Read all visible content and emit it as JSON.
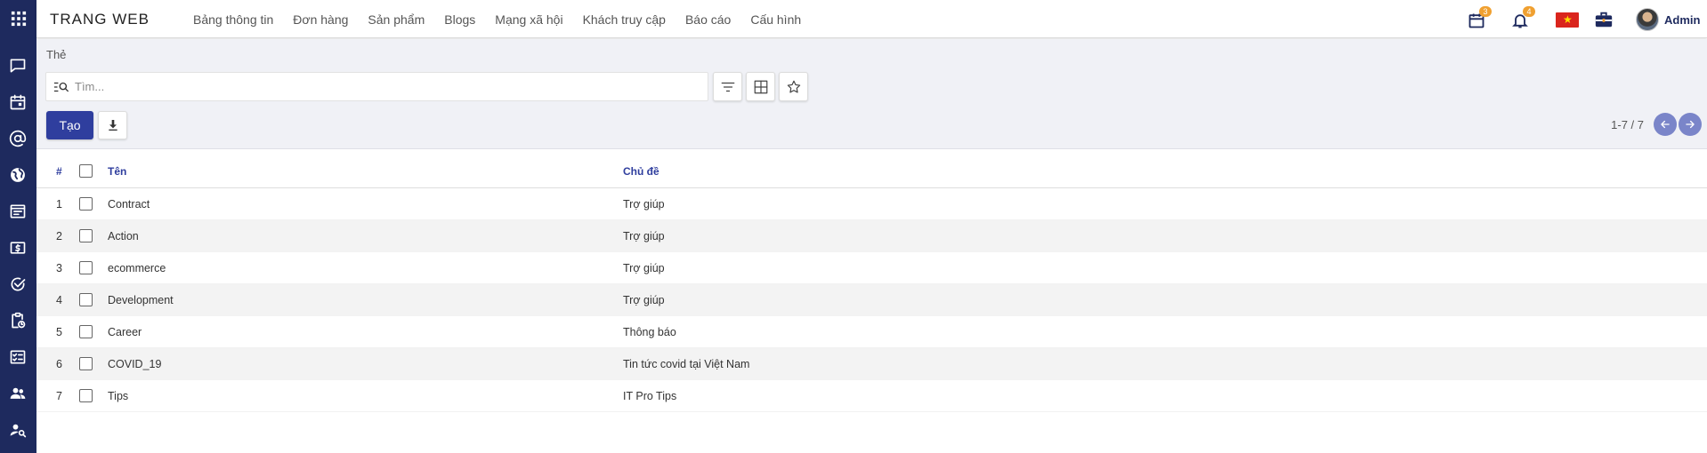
{
  "sidebar": {
    "icons": [
      "apps-icon",
      "chat-icon",
      "calendar-icon",
      "at-icon",
      "globe-icon",
      "newspaper-icon",
      "money-icon",
      "check-circle-icon",
      "clipboard-clock-icon",
      "task-list-icon",
      "users-icon",
      "user-search-icon"
    ]
  },
  "topbar": {
    "brand": "TRANG WEB",
    "menu": [
      "Bảng thông tin",
      "Đơn hàng",
      "Sản phẩm",
      "Blogs",
      "Mạng xã hội",
      "Khách truy cập",
      "Báo cáo",
      "Cấu hình"
    ],
    "activity_count": "3",
    "notification_count": "4",
    "user_name": "Admin"
  },
  "control_panel": {
    "breadcrumb": "Thẻ",
    "search_placeholder": "Tìm...",
    "create_label": "Tạo",
    "pager": "1-7 / 7"
  },
  "table": {
    "headers": {
      "num": "#",
      "name": "Tên",
      "topic": "Chủ đề"
    },
    "rows": [
      {
        "num": "1",
        "name": "Contract",
        "topic": "Trợ giúp"
      },
      {
        "num": "2",
        "name": "Action",
        "topic": "Trợ giúp"
      },
      {
        "num": "3",
        "name": "ecommerce",
        "topic": "Trợ giúp"
      },
      {
        "num": "4",
        "name": "Development",
        "topic": "Trợ giúp"
      },
      {
        "num": "5",
        "name": "Career",
        "topic": "Thông báo"
      },
      {
        "num": "6",
        "name": "COVID_19",
        "topic": "Tin tức covid tại Việt Nam"
      },
      {
        "num": "7",
        "name": "Tips",
        "topic": "IT Pro Tips"
      }
    ]
  },
  "colors": {
    "sidebar": "#1e2a5e",
    "primary": "#2f3e9e",
    "badge": "#f0a030",
    "pager_button": "#7a85c9"
  }
}
